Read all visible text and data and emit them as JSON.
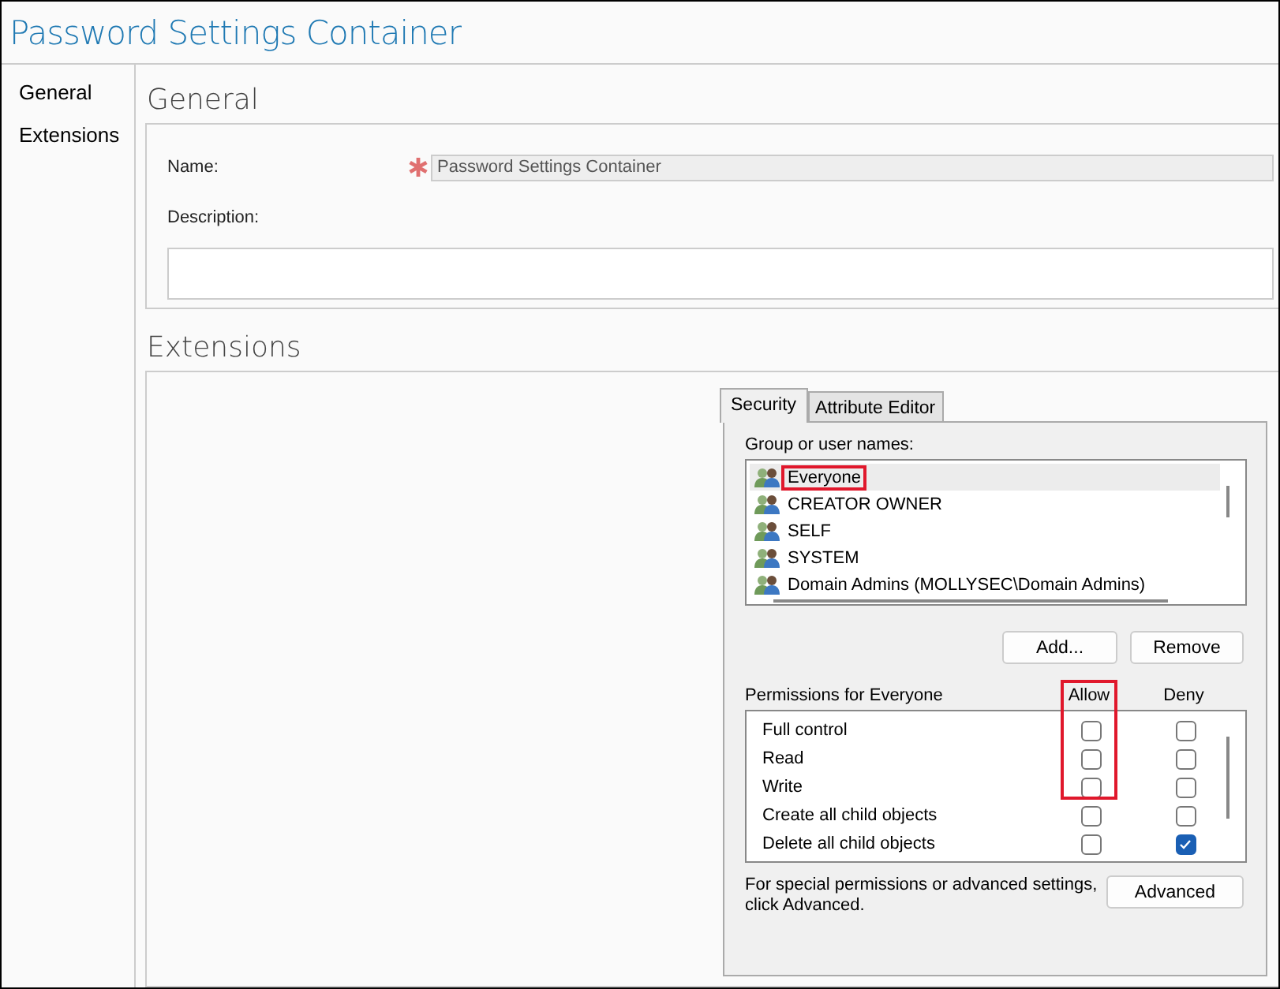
{
  "window": {
    "title": "Password Settings Container"
  },
  "sidebar": {
    "items": [
      {
        "label": "General",
        "selected": false
      },
      {
        "label": "Extensions",
        "selected": false
      }
    ]
  },
  "general": {
    "heading": "General",
    "name_label": "Name:",
    "required": true,
    "name_value": "Password Settings Container",
    "description_label": "Description:"
  },
  "extensions": {
    "heading": "Extensions",
    "tabs": [
      {
        "label": "Security",
        "selected": true
      },
      {
        "label": "Attribute Editor",
        "selected": false
      }
    ],
    "group_label": "Group or user names:",
    "principals": [
      {
        "name": "Everyone",
        "selected": true,
        "annotated": true
      },
      {
        "name": "CREATOR OWNER",
        "selected": false,
        "annotated": false
      },
      {
        "name": "SELF",
        "selected": false,
        "annotated": false
      },
      {
        "name": "SYSTEM",
        "selected": false,
        "annotated": false
      },
      {
        "name": "Domain Admins (MOLLYSEC\\Domain Admins)",
        "selected": false,
        "annotated": false
      }
    ],
    "buttons": [
      "Add...",
      "Remove"
    ],
    "permissions_label": "Permissions for Everyone",
    "allow_label": "Allow",
    "deny_label": "Deny",
    "permissions": [
      {
        "name": "Full control",
        "allow": false,
        "deny": false,
        "annotated": true
      },
      {
        "name": "Read",
        "allow": false,
        "deny": false,
        "annotated": true
      },
      {
        "name": "Write",
        "allow": false,
        "deny": false,
        "annotated": true
      },
      {
        "name": "Create all child objects",
        "allow": false,
        "deny": false,
        "annotated": false
      },
      {
        "name": "Delete all child objects",
        "allow": false,
        "deny": true,
        "annotated": false
      }
    ],
    "advanced_note": "For special permissions or advanced settings, click Advanced.",
    "advanced_button": "Advanced"
  }
}
